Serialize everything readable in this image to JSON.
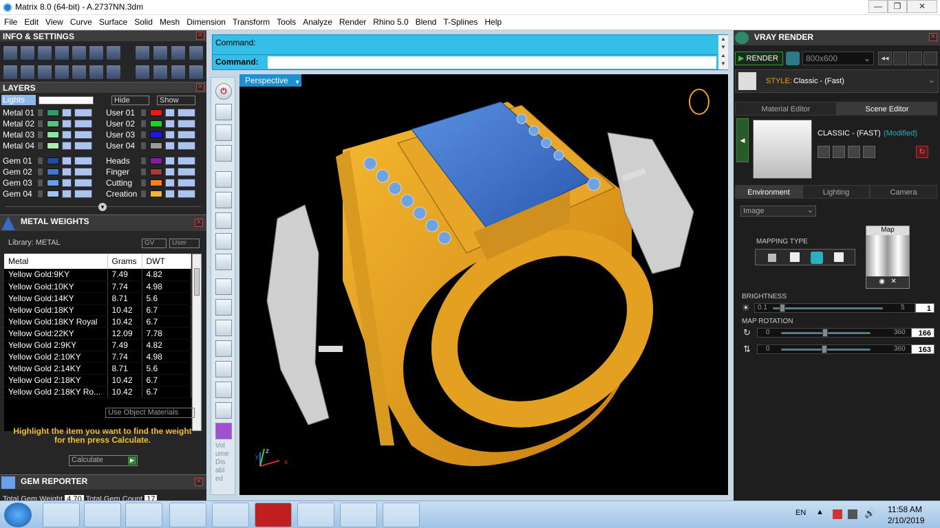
{
  "window": {
    "title": "Matrix 8.0 (64-bit) - A.2737NN.3dm",
    "min": "—",
    "max": "❐",
    "close": "✕"
  },
  "menu": [
    "File",
    "Edit",
    "View",
    "Curve",
    "Surface",
    "Solid",
    "Mesh",
    "Dimension",
    "Transform",
    "Tools",
    "Analyze",
    "Render",
    "Rhino 5.0",
    "Blend",
    "T-Splines",
    "Help"
  ],
  "info": {
    "title": "INFO & SETTINGS"
  },
  "layers": {
    "title": "LAYERS",
    "active": "Lights",
    "hide": "Hide",
    "show": "Show",
    "left": [
      {
        "name": "Metal 01",
        "color": "#2f9a6a"
      },
      {
        "name": "Metal 02",
        "color": "#59c47f"
      },
      {
        "name": "Metal 03",
        "color": "#8ee69b"
      },
      {
        "name": "Metal 04",
        "color": "#a8f0b0"
      },
      {
        "name": "Gem 01",
        "color": "#1a4fa8"
      },
      {
        "name": "Gem 02",
        "color": "#3d78d4"
      },
      {
        "name": "Gem 03",
        "color": "#6aa0e8"
      },
      {
        "name": "Gem 04",
        "color": "#9fc4f4"
      }
    ],
    "right": [
      {
        "name": "User 01",
        "color": "#e31c1c"
      },
      {
        "name": "User 02",
        "color": "#21d321"
      },
      {
        "name": "User 03",
        "color": "#1a1ae0"
      },
      {
        "name": "User 04",
        "color": "#9a9a9a"
      },
      {
        "name": "Heads",
        "color": "#8a1aa6"
      },
      {
        "name": "Finger",
        "color": "#a63a3a"
      },
      {
        "name": "Cutting",
        "color": "#ff7f1a"
      },
      {
        "name": "Creation",
        "color": "#f0b43a"
      }
    ]
  },
  "metal": {
    "title": "METAL WEIGHTS",
    "library": "Library: METAL",
    "gv": "GV",
    "user": "User",
    "headers": [
      "Metal",
      "Grams",
      "DWT"
    ],
    "rows": [
      [
        "Yellow Gold:9KY",
        "7.49",
        "4.82"
      ],
      [
        "Yellow Gold:10KY",
        "7.74",
        "4.98"
      ],
      [
        "Yellow Gold:14KY",
        "8.71",
        "5.6"
      ],
      [
        "Yellow Gold:18KY",
        "10.42",
        "6.7"
      ],
      [
        "Yellow Gold:18KY Royal",
        "10.42",
        "6.7"
      ],
      [
        "Yellow Gold:22KY",
        "12.09",
        "7.78"
      ],
      [
        "Yellow Gold 2:9KY",
        "7.49",
        "4.82"
      ],
      [
        "Yellow Gold 2:10KY",
        "7.74",
        "4.98"
      ],
      [
        "Yellow Gold 2:14KY",
        "8.71",
        "5.6"
      ],
      [
        "Yellow Gold 2:18KY",
        "10.42",
        "6.7"
      ],
      [
        "Yellow Gold 2:18KY Ro...",
        "10.42",
        "6.7"
      ]
    ],
    "use_obj": "Use Object Materials",
    "hint": "Highlight the item you want to find the weight for then press Calculate.",
    "calc": "Calculate"
  },
  "gem": {
    "title": "GEM REPORTER",
    "total_weight": "Total Gem Weight",
    "weight_val": "4.70",
    "total_count": "Total Gem Count",
    "count_val": "17"
  },
  "command": {
    "label1": "Command:",
    "label2": "Command:"
  },
  "viewport": {
    "name": "Perspective",
    "volume": [
      "Vol",
      "ume",
      "Dis",
      "abl",
      "ed"
    ],
    "axes": {
      "x": "x",
      "y": "y",
      "z": "z"
    }
  },
  "vray": {
    "title": "VRAY RENDER",
    "render": "RENDER",
    "resolution": "800x600",
    "style_label": "STYLE:",
    "style_value": "Classic - (Fast)",
    "tabs": [
      "Material Editor",
      "Scene Editor"
    ],
    "preset": "CLASSIC - (FAST)",
    "modified": "(Modified)",
    "subtabs": [
      "Environment",
      "Lighting",
      "Camera"
    ],
    "env_type": "Image",
    "mapping": "MAPPING TYPE",
    "map_label": "Map",
    "brightness": {
      "label": "BRIGHTNESS",
      "min": "0.1",
      "max": "5",
      "value": "1",
      "level": 0.06
    },
    "rotation": {
      "label": "MAP ROTATION",
      "r1": {
        "min": "0",
        "max": "360",
        "value": "166",
        "level": 0.46
      },
      "r2": {
        "min": "0",
        "max": "360",
        "value": "163",
        "level": 0.45
      }
    }
  },
  "taskbar": {
    "lang": "EN",
    "time": "11:58 AM",
    "date": "2/10/2019"
  }
}
